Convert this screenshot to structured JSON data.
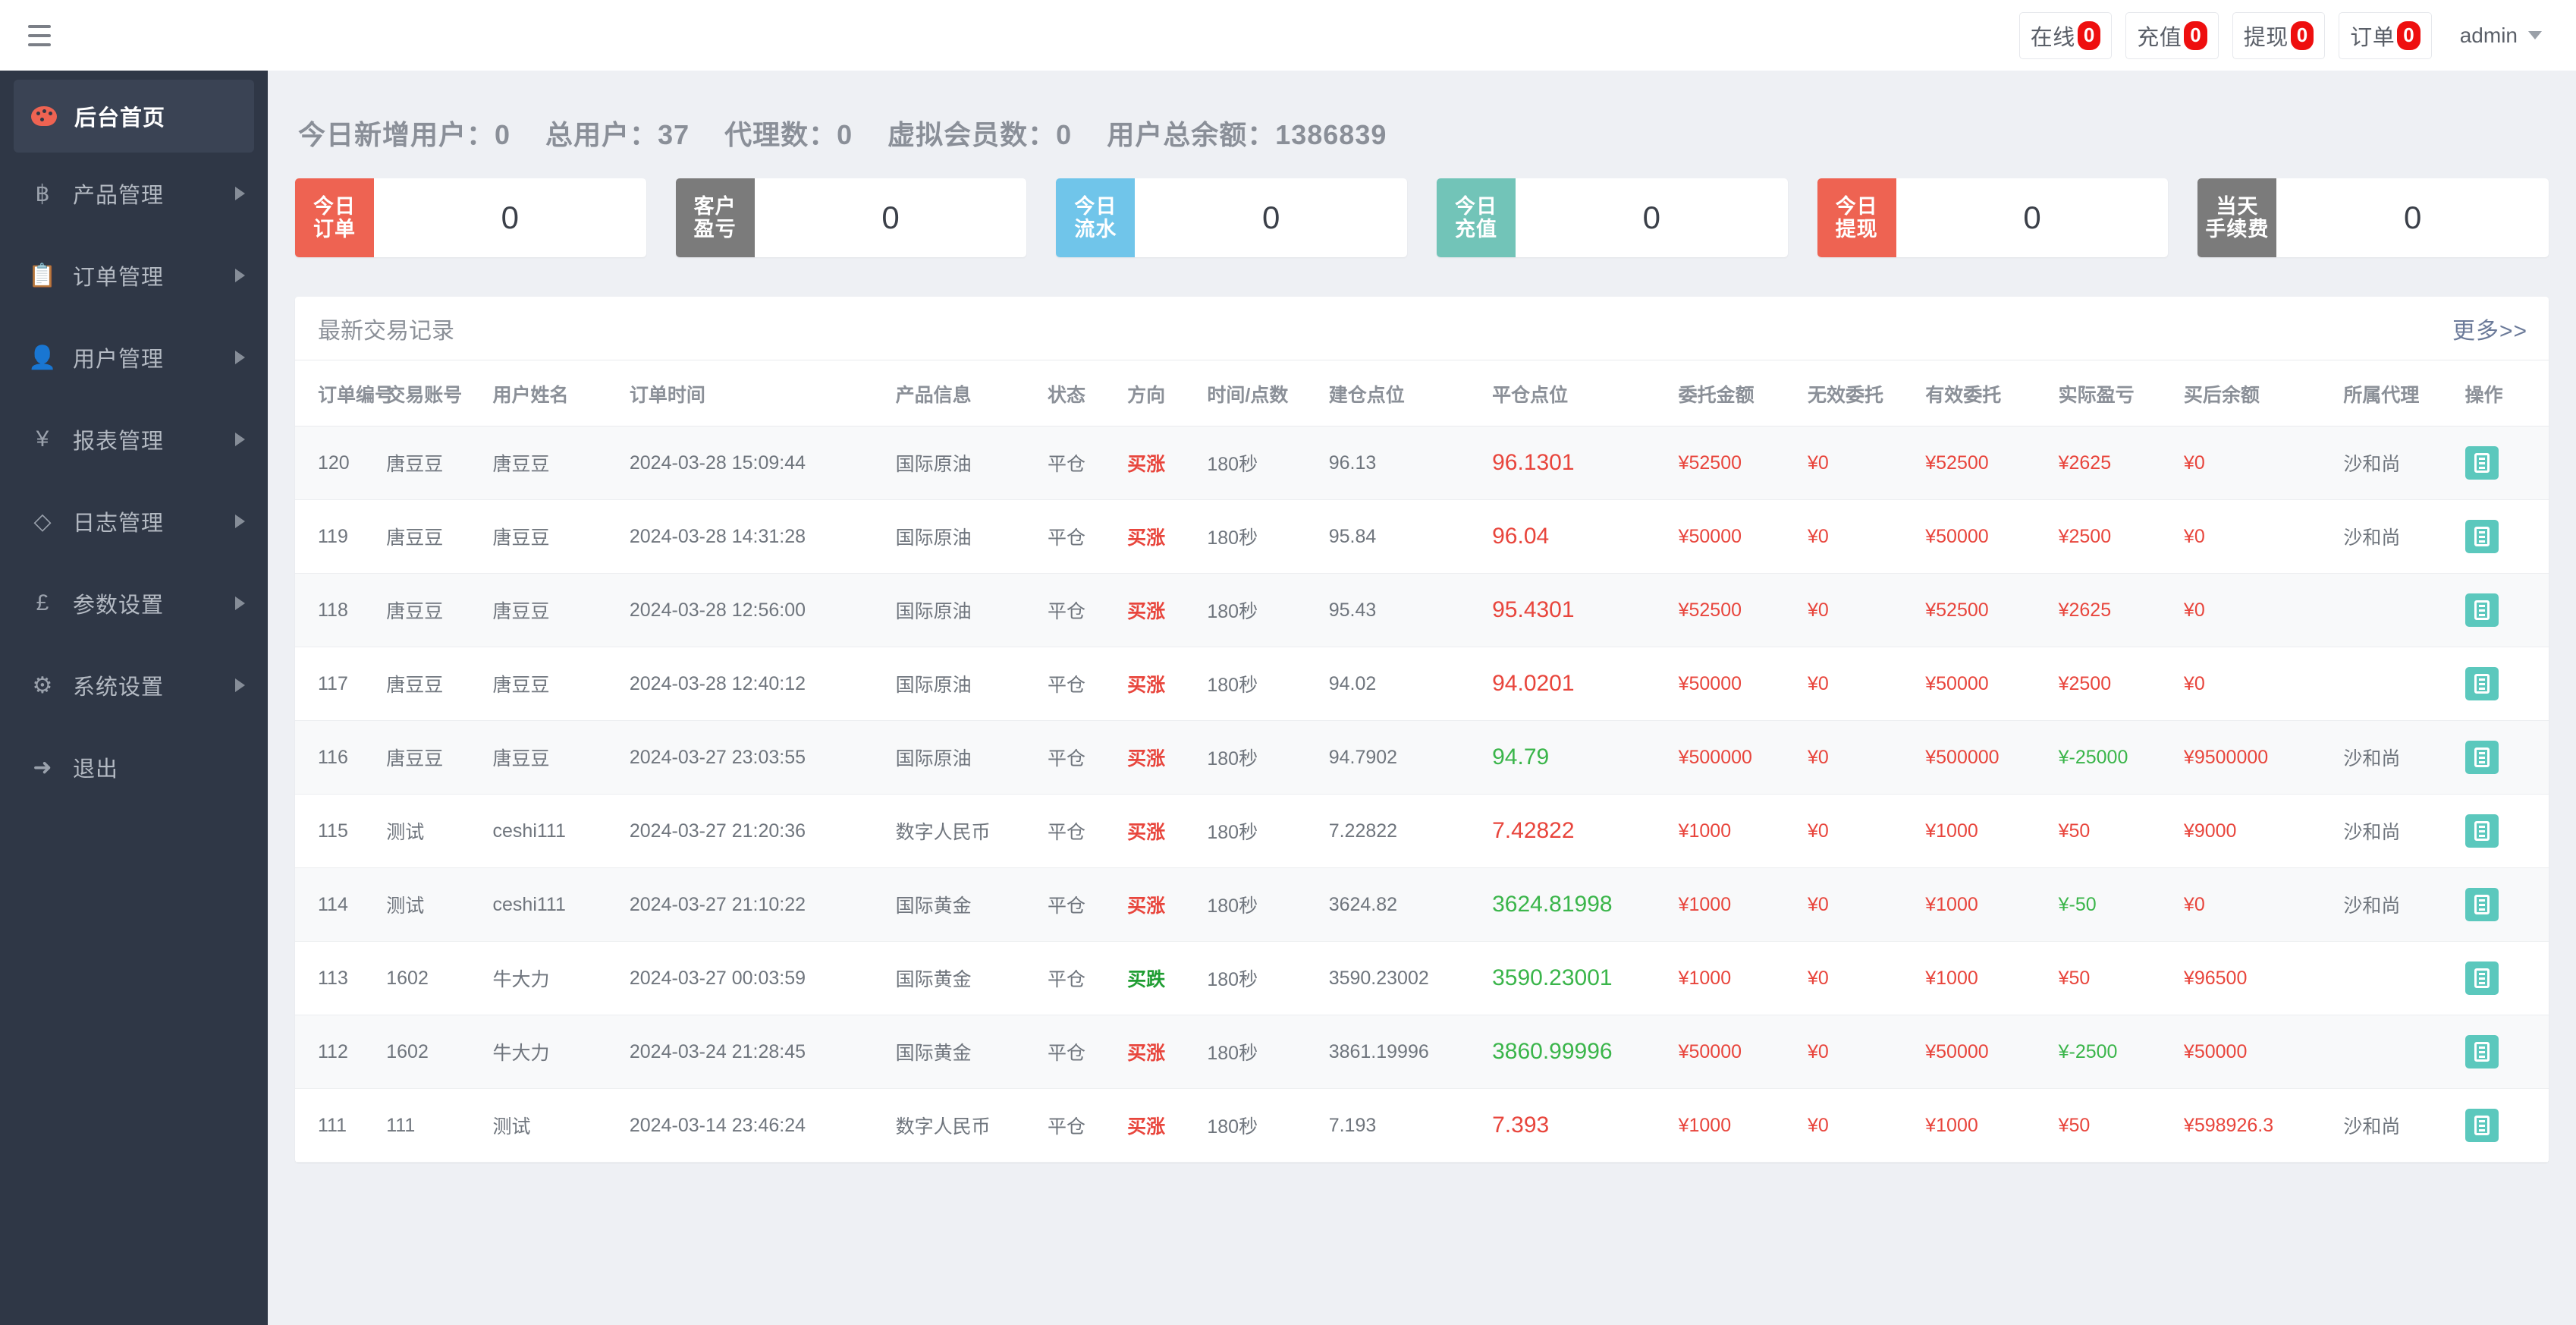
{
  "topbar": {
    "menu_icon": "hamburger-icon",
    "buttons": [
      {
        "label": "在线",
        "count": "0"
      },
      {
        "label": "充值",
        "count": "0"
      },
      {
        "label": "提现",
        "count": "0"
      },
      {
        "label": "订单",
        "count": "0"
      }
    ],
    "user": {
      "name": "admin",
      "caret": "chevron-down-icon"
    }
  },
  "sidebar": {
    "items": [
      {
        "label": "后台首页",
        "icon": "palette-icon",
        "active": true,
        "has_arrow": false
      },
      {
        "label": "产品管理",
        "icon": "bitcoin-icon",
        "active": false,
        "has_arrow": true
      },
      {
        "label": "订单管理",
        "icon": "copy-icon",
        "active": false,
        "has_arrow": true
      },
      {
        "label": "用户管理",
        "icon": "user-icon",
        "active": false,
        "has_arrow": true
      },
      {
        "label": "报表管理",
        "icon": "yen-icon",
        "active": false,
        "has_arrow": true
      },
      {
        "label": "日志管理",
        "icon": "layers-icon",
        "active": false,
        "has_arrow": true
      },
      {
        "label": "参数设置",
        "icon": "pound-icon",
        "active": false,
        "has_arrow": true
      },
      {
        "label": "系统设置",
        "icon": "gears-icon",
        "active": false,
        "has_arrow": true
      },
      {
        "label": "退出",
        "icon": "sign-out-icon",
        "active": false,
        "has_arrow": false
      }
    ]
  },
  "summary": [
    {
      "label": "今日新增用户：",
      "value": "0"
    },
    {
      "label": "总用户：",
      "value": "37"
    },
    {
      "label": "代理数：",
      "value": "0"
    },
    {
      "label": "虚拟会员数：",
      "value": "0"
    },
    {
      "label": "用户总余额：",
      "value": "1386839"
    }
  ],
  "cards": [
    {
      "line1": "今日",
      "line2": "订单",
      "value": "0",
      "color": "#ee6352"
    },
    {
      "line1": "客户",
      "line2": "盈亏",
      "value": "0",
      "color": "#7b7b7b"
    },
    {
      "line1": "今日",
      "line2": "流水",
      "value": "0",
      "color": "#70c5ea"
    },
    {
      "line1": "今日",
      "line2": "充值",
      "value": "0",
      "color": "#72c4b8"
    },
    {
      "line1": "今日",
      "line2": "提现",
      "value": "0",
      "color": "#ee6352"
    },
    {
      "line1": "当天",
      "line2": "手续费",
      "value": "0",
      "color": "#7b7b7b"
    }
  ],
  "panel": {
    "title": "最新交易记录",
    "more": "更多>>",
    "columns": [
      "订单编号",
      "交易账号",
      "用户姓名",
      "订单时间",
      "产品信息",
      "状态",
      "方向",
      "时间/点数",
      "建仓点位",
      "平仓点位",
      "委托金额",
      "无效委托",
      "有效委托",
      "实际盈亏",
      "买后余额",
      "所属代理",
      "操作"
    ],
    "op_icon": "list-detail-icon",
    "rows": [
      {
        "id": "120",
        "account": "唐豆豆",
        "user": "唐豆豆",
        "time": "2024-03-28 15:09:44",
        "product": "国际原油",
        "state": "平仓",
        "dir": "买涨",
        "dir_color": "red",
        "secs": "180秒",
        "open": "96.13",
        "close": "96.1301",
        "close_color": "red",
        "amount": "¥52500",
        "invalid": "¥0",
        "valid": "¥52500",
        "pnl": "¥2625",
        "pnl_color": "red",
        "balance": "¥0",
        "agent": "沙和尚"
      },
      {
        "id": "119",
        "account": "唐豆豆",
        "user": "唐豆豆",
        "time": "2024-03-28 14:31:28",
        "product": "国际原油",
        "state": "平仓",
        "dir": "买涨",
        "dir_color": "red",
        "secs": "180秒",
        "open": "95.84",
        "close": "96.04",
        "close_color": "red",
        "amount": "¥50000",
        "invalid": "¥0",
        "valid": "¥50000",
        "pnl": "¥2500",
        "pnl_color": "red",
        "balance": "¥0",
        "agent": "沙和尚"
      },
      {
        "id": "118",
        "account": "唐豆豆",
        "user": "唐豆豆",
        "time": "2024-03-28 12:56:00",
        "product": "国际原油",
        "state": "平仓",
        "dir": "买涨",
        "dir_color": "red",
        "secs": "180秒",
        "open": "95.43",
        "close": "95.4301",
        "close_color": "red",
        "amount": "¥52500",
        "invalid": "¥0",
        "valid": "¥52500",
        "pnl": "¥2625",
        "pnl_color": "red",
        "balance": "¥0",
        "agent": ""
      },
      {
        "id": "117",
        "account": "唐豆豆",
        "user": "唐豆豆",
        "time": "2024-03-28 12:40:12",
        "product": "国际原油",
        "state": "平仓",
        "dir": "买涨",
        "dir_color": "red",
        "secs": "180秒",
        "open": "94.02",
        "close": "94.0201",
        "close_color": "red",
        "amount": "¥50000",
        "invalid": "¥0",
        "valid": "¥50000",
        "pnl": "¥2500",
        "pnl_color": "red",
        "balance": "¥0",
        "agent": ""
      },
      {
        "id": "116",
        "account": "唐豆豆",
        "user": "唐豆豆",
        "time": "2024-03-27 23:03:55",
        "product": "国际原油",
        "state": "平仓",
        "dir": "买涨",
        "dir_color": "red",
        "secs": "180秒",
        "open": "94.7902",
        "close": "94.79",
        "close_color": "green",
        "amount": "¥500000",
        "invalid": "¥0",
        "valid": "¥500000",
        "pnl": "¥-25000",
        "pnl_color": "green",
        "balance": "¥9500000",
        "agent": "沙和尚"
      },
      {
        "id": "115",
        "account": "测试",
        "user": "ceshi111",
        "time": "2024-03-27 21:20:36",
        "product": "数字人民币",
        "state": "平仓",
        "dir": "买涨",
        "dir_color": "red",
        "secs": "180秒",
        "open": "7.22822",
        "close": "7.42822",
        "close_color": "red",
        "amount": "¥1000",
        "invalid": "¥0",
        "valid": "¥1000",
        "pnl": "¥50",
        "pnl_color": "red",
        "balance": "¥9000",
        "agent": "沙和尚"
      },
      {
        "id": "114",
        "account": "测试",
        "user": "ceshi111",
        "time": "2024-03-27 21:10:22",
        "product": "国际黄金",
        "state": "平仓",
        "dir": "买涨",
        "dir_color": "red",
        "secs": "180秒",
        "open": "3624.82",
        "close": "3624.81998",
        "close_color": "green",
        "amount": "¥1000",
        "invalid": "¥0",
        "valid": "¥1000",
        "pnl": "¥-50",
        "pnl_color": "green",
        "balance": "¥0",
        "agent": "沙和尚"
      },
      {
        "id": "113",
        "account": "1602",
        "user": "牛大力",
        "time": "2024-03-27 00:03:59",
        "product": "国际黄金",
        "state": "平仓",
        "dir": "买跌",
        "dir_color": "green",
        "secs": "180秒",
        "open": "3590.23002",
        "close": "3590.23001",
        "close_color": "green",
        "amount": "¥1000",
        "invalid": "¥0",
        "valid": "¥1000",
        "pnl": "¥50",
        "pnl_color": "red",
        "balance": "¥96500",
        "agent": ""
      },
      {
        "id": "112",
        "account": "1602",
        "user": "牛大力",
        "time": "2024-03-24 21:28:45",
        "product": "国际黄金",
        "state": "平仓",
        "dir": "买涨",
        "dir_color": "red",
        "secs": "180秒",
        "open": "3861.19996",
        "close": "3860.99996",
        "close_color": "green",
        "amount": "¥50000",
        "invalid": "¥0",
        "valid": "¥50000",
        "pnl": "¥-2500",
        "pnl_color": "green",
        "balance": "¥50000",
        "agent": ""
      },
      {
        "id": "111",
        "account": "111",
        "user": "测试",
        "time": "2024-03-14 23:46:24",
        "product": "数字人民币",
        "state": "平仓",
        "dir": "买涨",
        "dir_color": "red",
        "secs": "180秒",
        "open": "7.193",
        "close": "7.393",
        "close_color": "red",
        "amount": "¥1000",
        "invalid": "¥0",
        "valid": "¥1000",
        "pnl": "¥50",
        "pnl_color": "red",
        "balance": "¥598926.3",
        "agent": "沙和尚"
      }
    ]
  }
}
